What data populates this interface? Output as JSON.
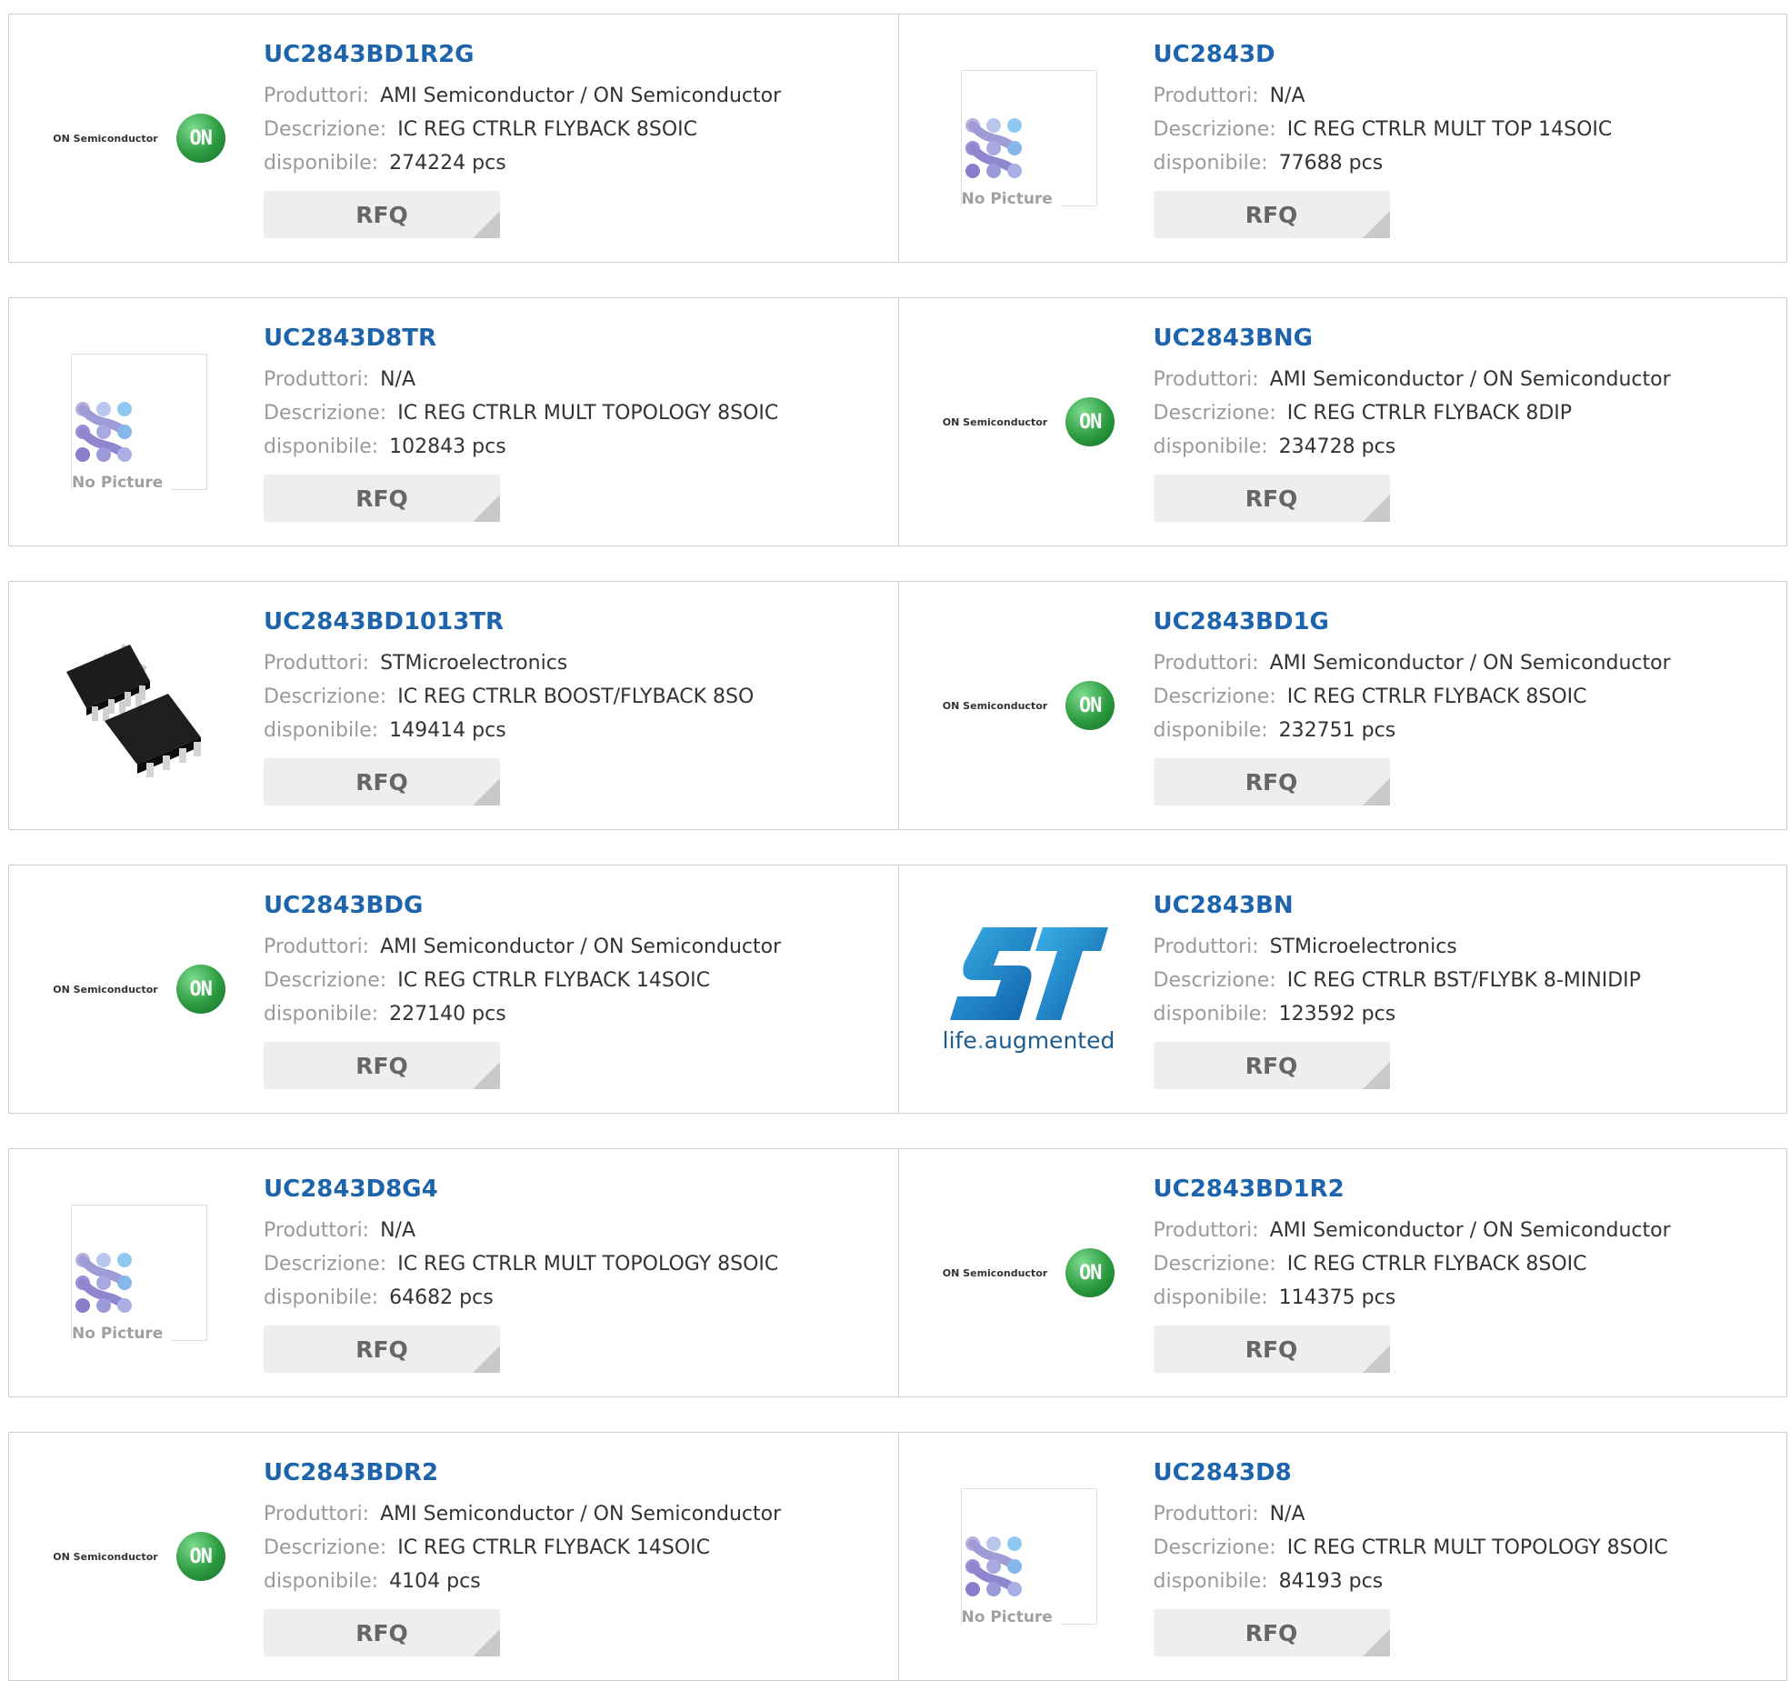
{
  "labels": {
    "manufacturer": "Produttori:",
    "description": "Descrizione:",
    "available": "disponibile:",
    "rfq": "RFQ"
  },
  "logos": {
    "on_text": "ON Semiconductor",
    "on_ball": "ON",
    "no_picture": "No Picture",
    "st_tagline_a": "life",
    "st_tagline_dot": ".",
    "st_tagline_b": "augmented"
  },
  "products": [
    {
      "part": "UC2843BD1R2G",
      "manufacturer": "AMI Semiconductor / ON Semiconductor",
      "description": "IC REG CTRLR FLYBACK 8SOIC",
      "available": "274224 pcs",
      "image": "on-semiconductor-logo"
    },
    {
      "part": "UC2843D",
      "manufacturer": "N/A",
      "description": "IC REG CTRLR MULT TOP 14SOIC",
      "available": "77688 pcs",
      "image": "no-picture"
    },
    {
      "part": "UC2843D8TR",
      "manufacturer": "N/A",
      "description": "IC REG CTRLR MULT TOPOLOGY 8SOIC",
      "available": "102843 pcs",
      "image": "no-picture"
    },
    {
      "part": "UC2843BNG",
      "manufacturer": "AMI Semiconductor / ON Semiconductor",
      "description": "IC REG CTRLR FLYBACK 8DIP",
      "available": "234728 pcs",
      "image": "on-semiconductor-logo"
    },
    {
      "part": "UC2843BD1013TR",
      "manufacturer": "STMicroelectronics",
      "description": "IC REG CTRLR BOOST/FLYBACK 8SO",
      "available": "149414 pcs",
      "image": "chip-photo"
    },
    {
      "part": "UC2843BD1G",
      "manufacturer": "AMI Semiconductor / ON Semiconductor",
      "description": "IC REG CTRLR FLYBACK 8SOIC",
      "available": "232751 pcs",
      "image": "on-semiconductor-logo"
    },
    {
      "part": "UC2843BDG",
      "manufacturer": "AMI Semiconductor / ON Semiconductor",
      "description": "IC REG CTRLR FLYBACK 14SOIC",
      "available": "227140 pcs",
      "image": "on-semiconductor-logo"
    },
    {
      "part": "UC2843BN",
      "manufacturer": "STMicroelectronics",
      "description": "IC REG CTRLR BST/FLYBK 8-MINIDIP",
      "available": "123592 pcs",
      "image": "st-logo"
    },
    {
      "part": "UC2843D8G4",
      "manufacturer": "N/A",
      "description": "IC REG CTRLR MULT TOPOLOGY 8SOIC",
      "available": "64682 pcs",
      "image": "no-picture"
    },
    {
      "part": "UC2843BD1R2",
      "manufacturer": "AMI Semiconductor / ON Semiconductor",
      "description": "IC REG CTRLR FLYBACK 8SOIC",
      "available": "114375 pcs",
      "image": "on-semiconductor-logo"
    },
    {
      "part": "UC2843BDR2",
      "manufacturer": "AMI Semiconductor / ON Semiconductor",
      "description": "IC REG CTRLR FLYBACK 14SOIC",
      "available": "4104 pcs",
      "image": "on-semiconductor-logo"
    },
    {
      "part": "UC2843D8",
      "manufacturer": "N/A",
      "description": "IC REG CTRLR MULT TOPOLOGY 8SOIC",
      "available": "84193 pcs",
      "image": "no-picture"
    }
  ]
}
